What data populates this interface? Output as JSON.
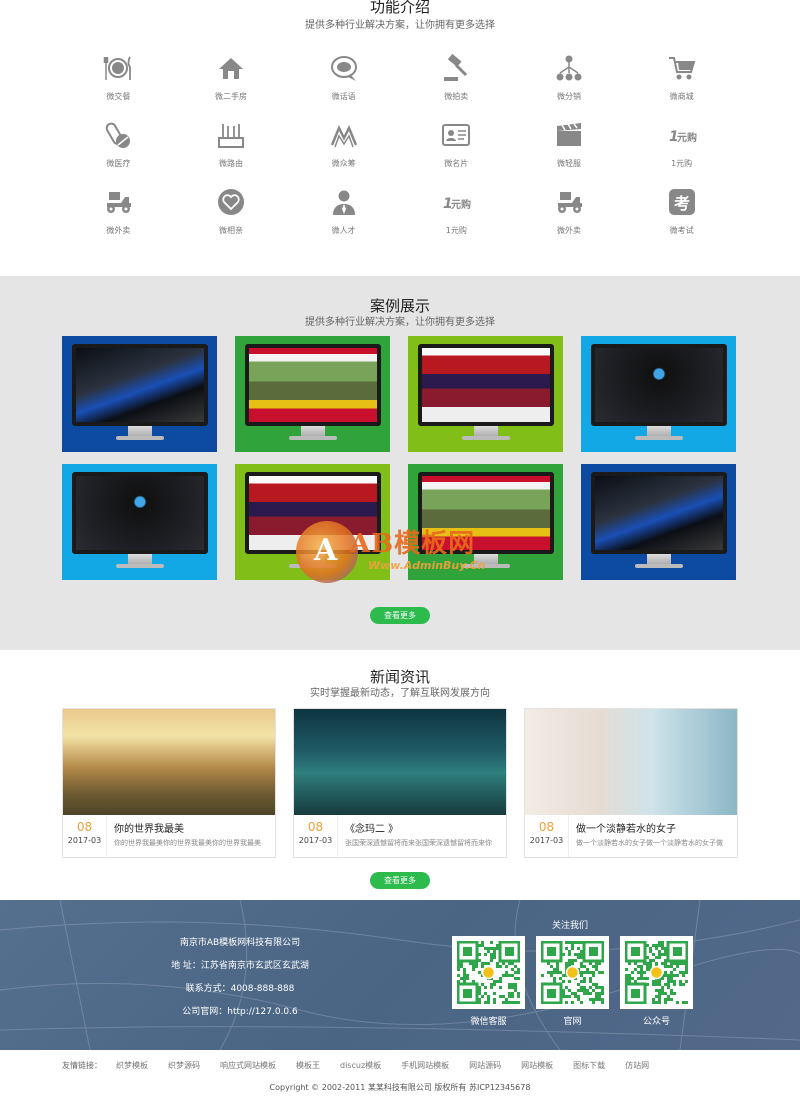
{
  "features": {
    "title": "功能介绍",
    "subtitle": "提供多种行业解决方案，让你拥有更多选择",
    "items": [
      {
        "label": "微交餐",
        "icon": "restaurant-icon"
      },
      {
        "label": "微二手房",
        "icon": "house-icon"
      },
      {
        "label": "微话语",
        "icon": "chat-icon"
      },
      {
        "label": "微拍卖",
        "icon": "auction-hammer-icon"
      },
      {
        "label": "微分销",
        "icon": "distribution-icon"
      },
      {
        "label": "微商城",
        "icon": "cart-icon"
      },
      {
        "label": "微医疗",
        "icon": "medical-icon"
      },
      {
        "label": "微路由",
        "icon": "router-icon"
      },
      {
        "label": "微众筹",
        "icon": "crowdfund-icon"
      },
      {
        "label": "微名片",
        "icon": "business-card-icon"
      },
      {
        "label": "微轻服",
        "icon": "clapperboard-icon"
      },
      {
        "label": "1元购",
        "icon": "one-yuan-icon"
      },
      {
        "label": "微外卖",
        "icon": "delivery-scooter-icon"
      },
      {
        "label": "微相亲",
        "icon": "heart-icon"
      },
      {
        "label": "微人才",
        "icon": "person-icon"
      },
      {
        "label": "1元购",
        "icon": "one-yuan-icon"
      },
      {
        "label": "微外卖",
        "icon": "delivery-scooter-icon"
      },
      {
        "label": "微考试",
        "icon": "exam-icon"
      }
    ]
  },
  "cases": {
    "title": "案例展示",
    "subtitle": "提供多种行业解决方案，让你拥有更多选择",
    "items": [
      {
        "bg": "#0d4aa2",
        "screen": "tech"
      },
      {
        "bg": "#30a33a",
        "screen": "horse"
      },
      {
        "bg": "#82be18",
        "screen": "stage"
      },
      {
        "bg": "#12a7e5",
        "screen": "dark"
      },
      {
        "bg": "#12a7e5",
        "screen": "dark"
      },
      {
        "bg": "#82be18",
        "screen": "stage"
      },
      {
        "bg": "#30a33a",
        "screen": "horse"
      },
      {
        "bg": "#0d4aa2",
        "screen": "tech"
      }
    ],
    "more_label": "查看更多"
  },
  "watermark": {
    "brand": "AB模板网",
    "url": "Www.AdminBuy.Cn"
  },
  "news": {
    "title": "新闻资讯",
    "subtitle": "实时掌握最新动态，了解互联网发展方向",
    "items": [
      {
        "day": "08",
        "ym": "2017-03",
        "title": "你的世界我最美",
        "desc": "你的世界我最美你的世界我最美你的世界我最美"
      },
      {
        "day": "08",
        "ym": "2017-03",
        "title": "《念玛二 》",
        "desc": "张国荣深遗憾留将而来张国荣深遗憾留将而来你"
      },
      {
        "day": "08",
        "ym": "2017-03",
        "title": "做一个淡静若水的女子",
        "desc": "做一个淡静若水的女子做一个淡静若水的女子做"
      }
    ],
    "more_label": "查看更多"
  },
  "footer": {
    "company": "南京市AB模板网科技有限公司",
    "address": "地 址：江苏省南京市玄武区玄武湖",
    "phone": "联系方式：4008-888-888",
    "website": "公司官网：http://127.0.0.6",
    "follow_title": "关注我们",
    "qrs": [
      {
        "label": "微信客服"
      },
      {
        "label": "官网"
      },
      {
        "label": "公众号"
      }
    ]
  },
  "links": {
    "lead": "友情链接：",
    "items": [
      "织梦模板",
      "织梦源码",
      "响应式网站模板",
      "模板王",
      "discuz模板",
      "手机网站模板",
      "网站源码",
      "网站模板",
      "图标下载",
      "仿站网"
    ]
  },
  "copyright": "Copyright © 2002-2011 某某科技有限公司 版权所有 苏ICP12345678"
}
